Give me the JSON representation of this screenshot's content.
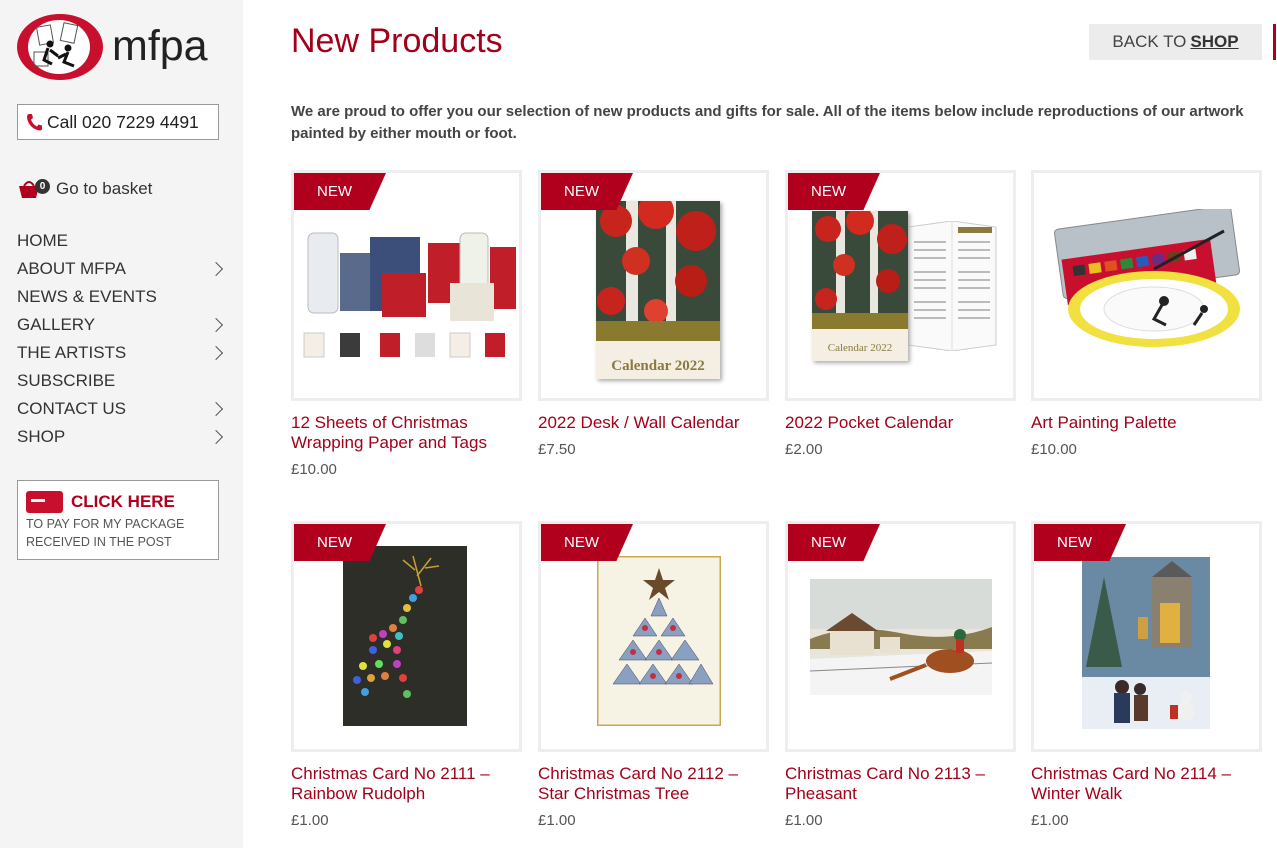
{
  "brand": {
    "name": "mfpa"
  },
  "sidebar": {
    "call_label": "Call 020 7229 4491",
    "basket_count": "0",
    "basket_label": "Go to basket",
    "nav": [
      {
        "label": "HOME",
        "has_children": false
      },
      {
        "label": "ABOUT MFPA",
        "has_children": true
      },
      {
        "label": "NEWS & EVENTS",
        "has_children": false
      },
      {
        "label": "GALLERY",
        "has_children": true
      },
      {
        "label": "THE ARTISTS",
        "has_children": true
      },
      {
        "label": "SUBSCRIBE",
        "has_children": false
      },
      {
        "label": "CONTACT US",
        "has_children": true
      },
      {
        "label": "SHOP",
        "has_children": true
      }
    ],
    "pay_title": "CLICK HERE",
    "pay_line1": "TO PAY FOR MY PACKAGE",
    "pay_line2": "RECEIVED IN THE POST"
  },
  "main": {
    "title": "New Products",
    "back_prefix": "BACK TO",
    "back_link": "SHOP",
    "intro": "We are proud to offer you our selection of new products and gifts for sale. All of the items below include reproductions of our artwork painted by either mouth or foot.",
    "badge": "NEW",
    "products": [
      {
        "name": "12 Sheets of Christmas Wrapping Paper and Tags",
        "price": "£10.00"
      },
      {
        "name": "2022 Desk / Wall Calendar",
        "price": "£7.50",
        "cover_text": "Calendar 2022"
      },
      {
        "name": "2022 Pocket Calendar",
        "price": "£2.00",
        "cover_text": "Calendar 2022"
      },
      {
        "name": "Art Painting Palette",
        "price": "£10.00"
      },
      {
        "name": "Christmas Card No 2111 – Rainbow Rudolph",
        "price": "£1.00"
      },
      {
        "name": "Christmas Card No 2112 – Star Christmas Tree",
        "price": "£1.00"
      },
      {
        "name": "Christmas Card No 2113 – Pheasant",
        "price": "£1.00"
      },
      {
        "name": "Christmas Card No 2114 – Winter Walk",
        "price": "£1.00"
      }
    ]
  },
  "colors": {
    "brand_red": "#b0001e",
    "title_red": "#a3001c",
    "sidebar_bg": "#f4f4f4"
  }
}
